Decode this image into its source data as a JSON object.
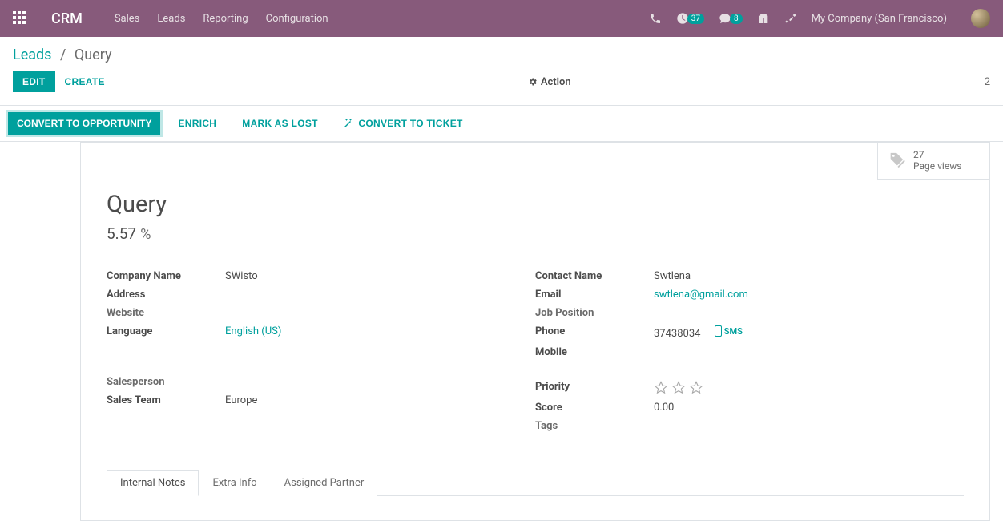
{
  "topbar": {
    "brand": "CRM",
    "menu": [
      "Sales",
      "Leads",
      "Reporting",
      "Configuration"
    ],
    "company": "My Company (San Francisco)",
    "activities_count": "37",
    "messages_count": "8"
  },
  "breadcrumb": {
    "parent": "Leads",
    "current": "Query"
  },
  "control": {
    "edit": "EDIT",
    "create": "CREATE",
    "action": "Action",
    "pager": "2"
  },
  "statusbar": {
    "convert_opp": "CONVERT TO OPPORTUNITY",
    "enrich": "ENRICH",
    "mark_lost": "MARK AS LOST",
    "convert_ticket": "CONVERT TO TICKET"
  },
  "statbox": {
    "count": "27",
    "label": "Page views"
  },
  "record": {
    "title": "Query",
    "probability": "5.57",
    "probability_unit": "%",
    "left": {
      "company_name_label": "Company Name",
      "company_name": "SWisto",
      "address_label": "Address",
      "address": "",
      "website_label": "Website",
      "website": "",
      "language_label": "Language",
      "language": "English (US)",
      "salesperson_label": "Salesperson",
      "salesperson": "",
      "sales_team_label": "Sales Team",
      "sales_team": "Europe"
    },
    "right": {
      "contact_name_label": "Contact Name",
      "contact_name": "Swtlena",
      "email_label": "Email",
      "email": "swtlena@gmail.com",
      "job_position_label": "Job Position",
      "job_position": "",
      "phone_label": "Phone",
      "phone": "37438034",
      "sms_label": "SMS",
      "mobile_label": "Mobile",
      "mobile": "",
      "priority_label": "Priority",
      "score_label": "Score",
      "score": "0.00",
      "tags_label": "Tags",
      "tags": ""
    }
  },
  "tabs": {
    "internal_notes": "Internal Notes",
    "extra_info": "Extra Info",
    "assigned_partner": "Assigned Partner"
  }
}
